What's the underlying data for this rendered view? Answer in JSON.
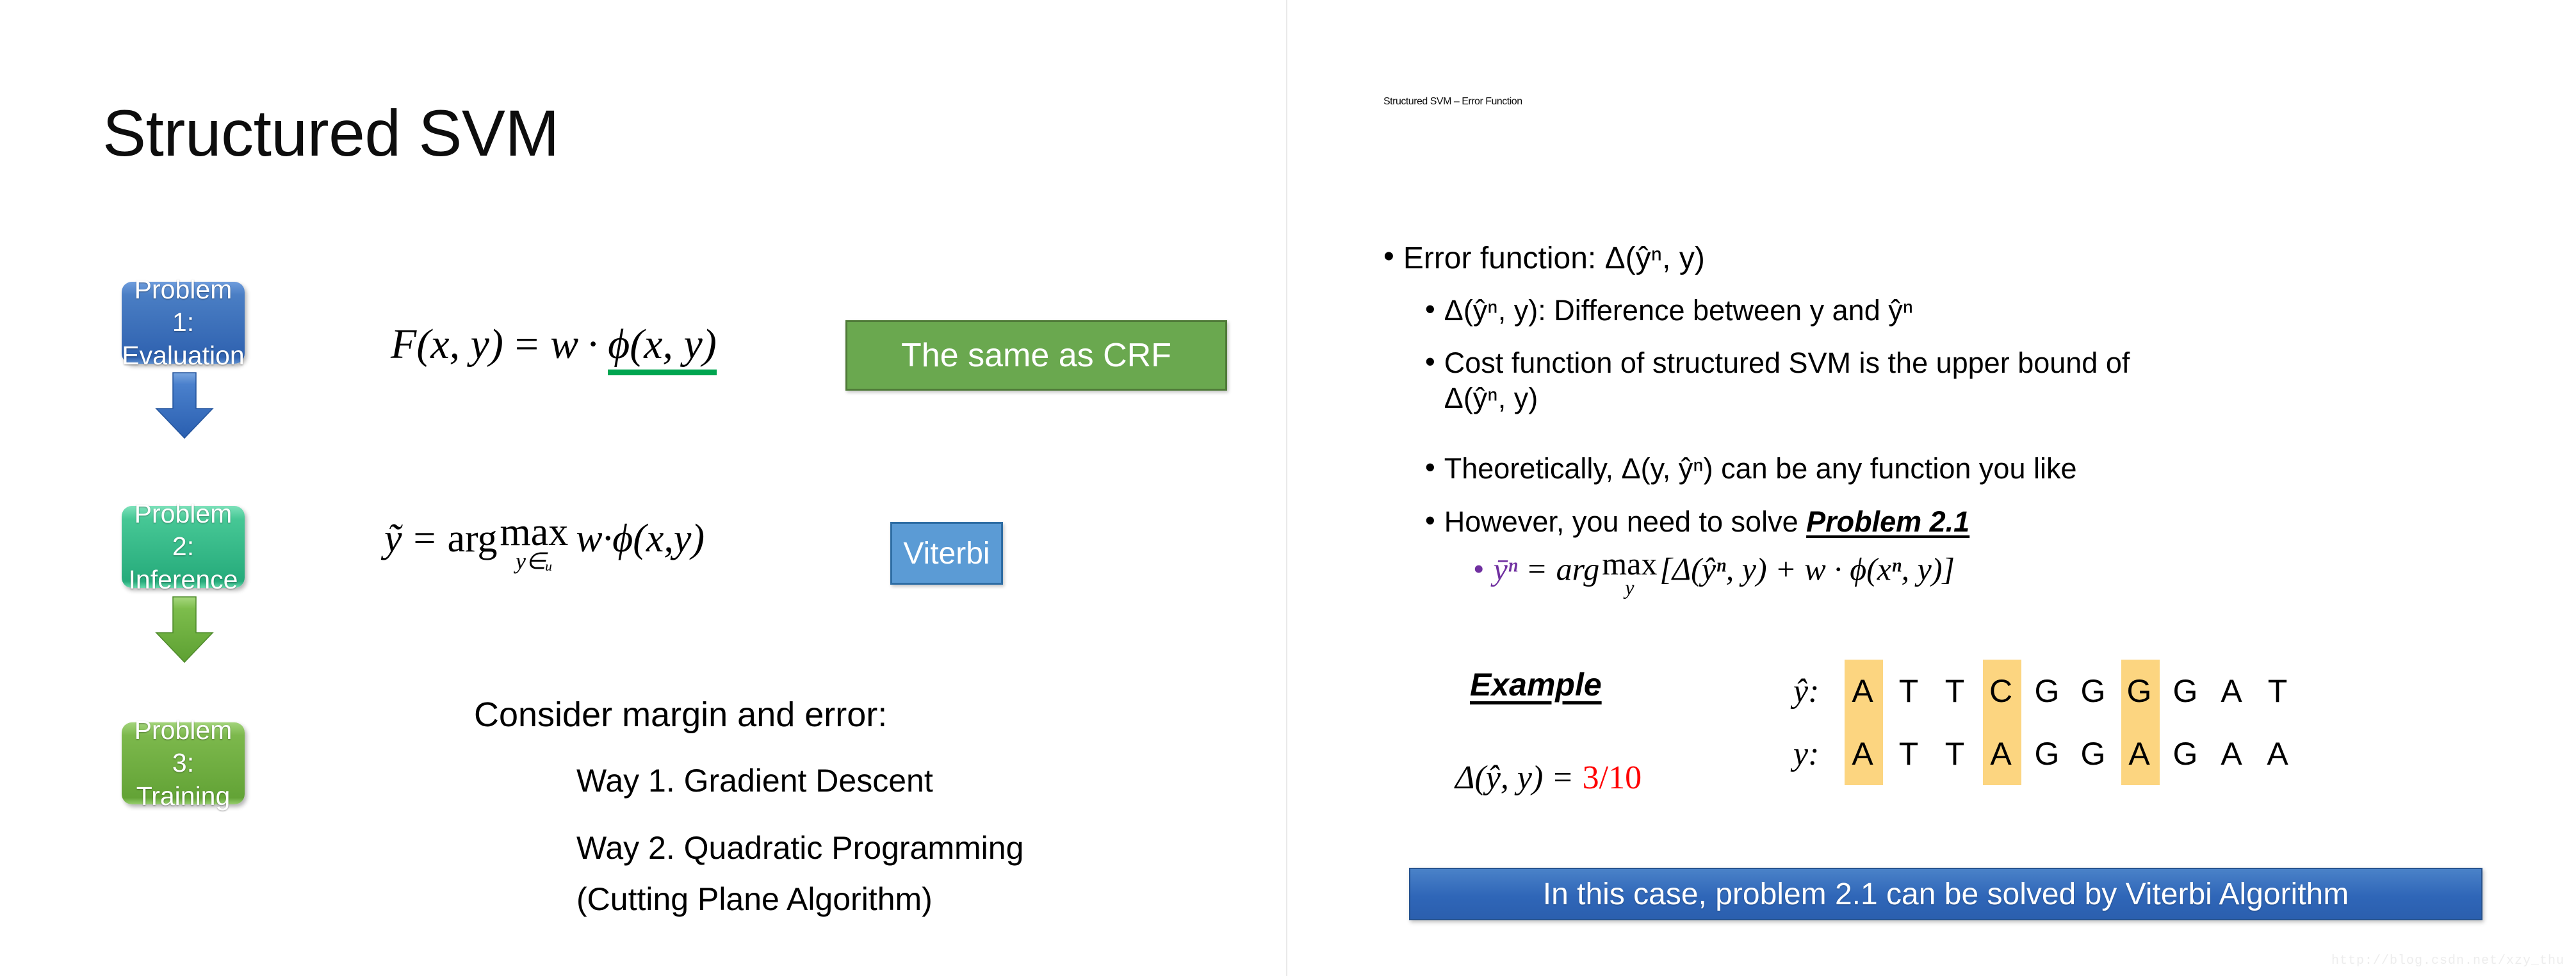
{
  "colors": {
    "box1": "#4472C4",
    "box2": "#3ECB97",
    "box3": "#70AD47",
    "crf_badge": "#6AA84F",
    "viterbi_badge": "#5B9BD5",
    "banner": "#2F66B8",
    "highlight": "#FCD580",
    "red_fraction": "#FF0000",
    "purple_var": "#7030A0",
    "phi_underline": "#00A550"
  },
  "left_slide": {
    "title": "Structured SVM",
    "flow": [
      {
        "line1": "Problem 1:",
        "line2": "Evaluation"
      },
      {
        "line1": "Problem 2:",
        "line2": "Inference"
      },
      {
        "line1": "Problem 3:",
        "line2": "Training"
      }
    ],
    "arrows": [
      "down-arrow-blue",
      "down-arrow-green"
    ],
    "formula_1": {
      "lhs": "F(x, y)",
      "eq": "=",
      "rhs_w": "w",
      "dot": "·",
      "rhs_phi": "ϕ(x, y)"
    },
    "crf_badge": "The same as CRF",
    "formula_2": {
      "lhs": "ỹ",
      "eq": "=",
      "arg": "arg",
      "max_top": "max",
      "max_bottom": "y∈ᵤ",
      "rhs": "w·ϕ(x,y)"
    },
    "viterbi_badge": "Viterbi",
    "consider_heading": "Consider margin and error:",
    "ways": [
      "Way 1. Gradient Descent",
      "Way 2. Quadratic Programming",
      "(Cutting Plane Algorithm)"
    ]
  },
  "right_slide": {
    "title": "Structured SVM – Error Function",
    "bullets": [
      {
        "level": 1,
        "marker": "•",
        "text": "Error function: Δ(ŷⁿ, y)"
      },
      {
        "level": 2,
        "marker": "•",
        "text": "Δ(ŷⁿ, y): Difference between y and ŷⁿ"
      },
      {
        "level": 2,
        "marker": "•",
        "text_part1": "Cost function of structured SVM is the upper bound of",
        "text_part2": "Δ(ŷⁿ, y)"
      },
      {
        "level": 2,
        "marker": "•",
        "text": "Theoretically, Δ(y, ŷⁿ) can be any function you like"
      },
      {
        "level": 2,
        "marker": "•",
        "text_prefix": "However, you need to solve ",
        "emphasis": "Problem 2.1"
      }
    ],
    "purple_formula": {
      "bullet": "•",
      "lhs": "ȳⁿ",
      "eq": "=",
      "arg": "arg",
      "max_top": "max",
      "max_bottom": "y",
      "rhs": "[Δ(ŷⁿ, y) + w · ϕ(xⁿ, y)]"
    },
    "example": {
      "label": "Example",
      "delta_lhs": "Δ(ŷ, y)",
      "delta_eq": "=",
      "delta_value": "3/10",
      "row_yhat": {
        "label": "ŷ:",
        "chars": [
          "A",
          "T",
          "T",
          "C",
          "G",
          "G",
          "G",
          "G",
          "A",
          "T"
        ]
      },
      "row_y": {
        "label": "y:",
        "chars": [
          "A",
          "T",
          "T",
          "A",
          "G",
          "G",
          "A",
          "G",
          "A",
          "A"
        ]
      },
      "highlight_positions": [
        4,
        7,
        10
      ]
    },
    "banner": "In this case, problem 2.1 can be solved by Viterbi Algorithm"
  },
  "watermark": "http://blog.csdn.net/xzy_thu"
}
